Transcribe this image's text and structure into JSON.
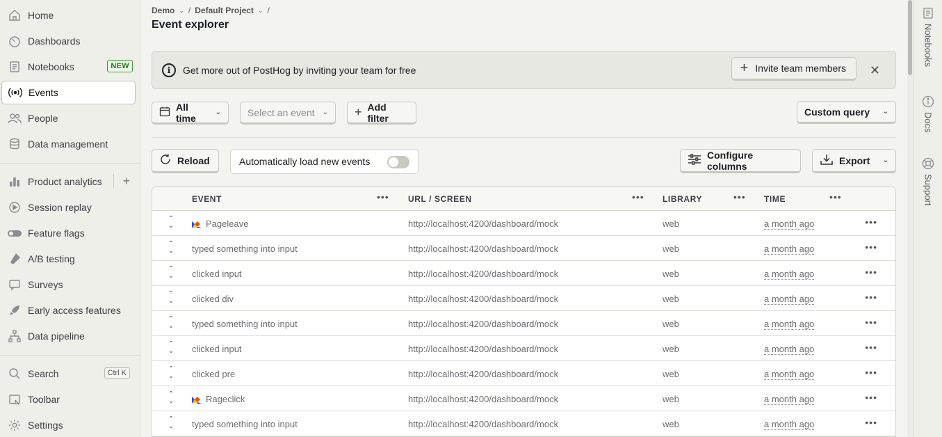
{
  "sidebar": {
    "items": [
      {
        "label": "Home",
        "icon": "home-icon"
      },
      {
        "label": "Dashboards",
        "icon": "dashboard-icon"
      },
      {
        "label": "Notebooks",
        "icon": "notebook-icon",
        "badge": "NEW"
      },
      {
        "label": "Events",
        "icon": "broadcast-icon",
        "active": true
      },
      {
        "label": "People",
        "icon": "people-icon"
      },
      {
        "label": "Data management",
        "icon": "database-icon"
      },
      {
        "label": "Product analytics",
        "icon": "bar-chart-icon"
      },
      {
        "label": "Session replay",
        "icon": "replay-icon"
      },
      {
        "label": "Feature flags",
        "icon": "toggle-icon"
      },
      {
        "label": "A/B testing",
        "icon": "flask-icon"
      },
      {
        "label": "Surveys",
        "icon": "survey-icon"
      },
      {
        "label": "Early access features",
        "icon": "rocket-icon"
      },
      {
        "label": "Data pipeline",
        "icon": "pipeline-icon"
      },
      {
        "label": "Search",
        "icon": "search-icon",
        "shortcut": "Ctrl K"
      },
      {
        "label": "Toolbar",
        "icon": "toolbar-icon"
      },
      {
        "label": "Settings",
        "icon": "gear-icon"
      }
    ]
  },
  "breadcrumb": {
    "org": "Demo",
    "project": "Default Project",
    "sep": "/"
  },
  "page": {
    "title": "Event explorer"
  },
  "banner": {
    "message": "Get more out of PostHog by inviting your team for free",
    "invite_label": "Invite team members"
  },
  "filters": {
    "time_label": "All time",
    "event_placeholder": "Select an event",
    "add_filter_label": "Add filter",
    "custom_query_label": "Custom query"
  },
  "actions": {
    "reload_label": "Reload",
    "auto_load_label": "Automatically load new events",
    "configure_label": "Configure columns",
    "export_label": "Export"
  },
  "table": {
    "columns": [
      "EVENT",
      "URL / SCREEN",
      "LIBRARY",
      "TIME"
    ],
    "rows": [
      {
        "event": "Pageleave",
        "logo": true,
        "url": "http://localhost:4200/dashboard/mock",
        "library": "web",
        "time": "a month ago"
      },
      {
        "event": "typed something into input",
        "logo": false,
        "url": "http://localhost:4200/dashboard/mock",
        "library": "web",
        "time": "a month ago"
      },
      {
        "event": "clicked input",
        "logo": false,
        "url": "http://localhost:4200/dashboard/mock",
        "library": "web",
        "time": "a month ago"
      },
      {
        "event": "clicked div",
        "logo": false,
        "url": "http://localhost:4200/dashboard/mock",
        "library": "web",
        "time": "a month ago"
      },
      {
        "event": "typed something into input",
        "logo": false,
        "url": "http://localhost:4200/dashboard/mock",
        "library": "web",
        "time": "a month ago"
      },
      {
        "event": "clicked input",
        "logo": false,
        "url": "http://localhost:4200/dashboard/mock",
        "library": "web",
        "time": "a month ago"
      },
      {
        "event": "clicked pre",
        "logo": false,
        "url": "http://localhost:4200/dashboard/mock",
        "library": "web",
        "time": "a month ago"
      },
      {
        "event": "Rageclick",
        "logo": true,
        "url": "http://localhost:4200/dashboard/mock",
        "library": "web",
        "time": "a month ago"
      },
      {
        "event": "typed something into input",
        "logo": false,
        "url": "http://localhost:4200/dashboard/mock",
        "library": "web",
        "time": "a month ago"
      }
    ]
  },
  "rail": {
    "items": [
      {
        "label": "Notebooks",
        "icon": "notebook-icon"
      },
      {
        "label": "Docs",
        "icon": "info-icon"
      },
      {
        "label": "Support",
        "icon": "lifebuoy-icon"
      }
    ]
  }
}
